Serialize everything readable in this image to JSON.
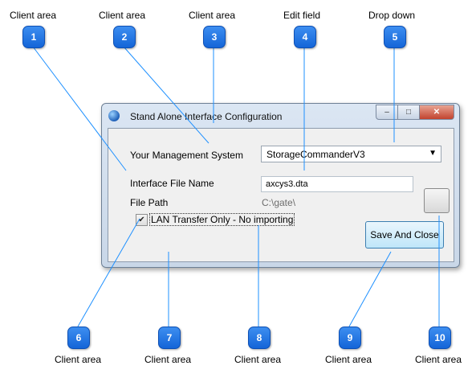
{
  "callouts": [
    {
      "number": "1",
      "label": "Client area"
    },
    {
      "number": "2",
      "label": "Client area"
    },
    {
      "number": "3",
      "label": "Client area"
    },
    {
      "number": "4",
      "label": "Edit field"
    },
    {
      "number": "5",
      "label": "Drop down"
    },
    {
      "number": "6",
      "label": "Client area"
    },
    {
      "number": "7",
      "label": "Client area"
    },
    {
      "number": "8",
      "label": "Client area"
    },
    {
      "number": "9",
      "label": "Client area"
    },
    {
      "number": "10",
      "label": "Client area"
    }
  ],
  "window": {
    "title": "Stand Alone Interface Configuration",
    "icon": "globe-icon",
    "buttons": {
      "minimize": "–",
      "maximize": "□",
      "close": "✕"
    }
  },
  "form": {
    "management_label": "Your Management System",
    "management_value": "StorageCommanderV3",
    "file_name_label": "Interface File Name",
    "file_name_value": "axcys3.dta",
    "file_path_label": "File Path",
    "file_path_value": "C:\\gate\\",
    "checkbox_label": "LAN Transfer Only - No importing",
    "checkbox_checked": true,
    "save_label": "Save And Close"
  },
  "colors": {
    "callout_badge": "#1a6fe0",
    "callout_line": "#1e90ff"
  }
}
